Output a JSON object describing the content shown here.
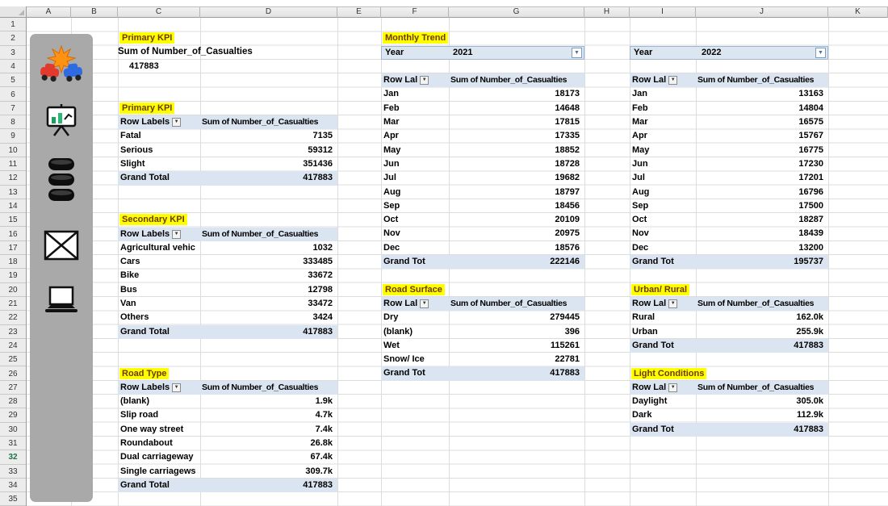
{
  "sheet": {
    "columns": [
      "A",
      "B",
      "C",
      "D",
      "E",
      "F",
      "G",
      "H",
      "I",
      "J",
      "K"
    ],
    "row_count": 35,
    "active_row": 32
  },
  "sidebar": {
    "icons": [
      "car-crash-icon",
      "presentation-chart-icon",
      "database-icon",
      "envelope-icon",
      "laptop-icon"
    ]
  },
  "kpi": {
    "title": "Primary KPI",
    "measure": "Sum of Number_of_Casualties",
    "value": "417883"
  },
  "monthly_trend": {
    "title": "Monthly Trend",
    "filters": [
      {
        "label": "Year",
        "value": "2021"
      },
      {
        "label": "Year",
        "value": "2022"
      }
    ]
  },
  "tables": {
    "primary_kpi": {
      "title": "Primary KPI",
      "header": [
        "Row Labels",
        "Sum of Number_of_Casualties"
      ],
      "rows": [
        [
          "Fatal",
          "7135"
        ],
        [
          "Serious",
          "59312"
        ],
        [
          "Slight",
          "351436"
        ]
      ],
      "total": [
        "Grand Total",
        "417883"
      ]
    },
    "secondary_kpi": {
      "title": "Secondary KPI",
      "header": [
        "Row Labels",
        "Sum of Number_of_Casualties"
      ],
      "rows": [
        [
          "Agricultural vehic",
          "1032"
        ],
        [
          "Cars",
          "333485"
        ],
        [
          "Bike",
          "33672"
        ],
        [
          "Bus",
          "12798"
        ],
        [
          "Van",
          "33472"
        ],
        [
          "Others",
          "3424"
        ]
      ],
      "total": [
        "Grand Total",
        "417883"
      ]
    },
    "road_type": {
      "title": "Road Type",
      "header": [
        "Row Labels",
        "Sum of Number_of_Casualties"
      ],
      "rows": [
        [
          "(blank)",
          "1.9k"
        ],
        [
          "Slip road",
          "4.7k"
        ],
        [
          "One way street",
          "7.4k"
        ],
        [
          "Roundabout",
          "26.8k"
        ],
        [
          "Dual carriageway",
          "67.4k"
        ],
        [
          "Single carriagews",
          "309.7k"
        ]
      ],
      "total": [
        "Grand Total",
        "417883"
      ]
    },
    "monthly_2021": {
      "header": [
        "Row Lal",
        "Sum of Number_of_Casualties"
      ],
      "rows": [
        [
          "Jan",
          "18173"
        ],
        [
          "Feb",
          "14648"
        ],
        [
          "Mar",
          "17815"
        ],
        [
          "Apr",
          "17335"
        ],
        [
          "May",
          "18852"
        ],
        [
          "Jun",
          "18728"
        ],
        [
          "Jul",
          "19682"
        ],
        [
          "Aug",
          "18797"
        ],
        [
          "Sep",
          "18456"
        ],
        [
          "Oct",
          "20109"
        ],
        [
          "Nov",
          "20975"
        ],
        [
          "Dec",
          "18576"
        ]
      ],
      "total": [
        "Grand Tot",
        "222146"
      ]
    },
    "monthly_2022": {
      "header": [
        "Row Lal",
        "Sum of Number_of_Casualties"
      ],
      "rows": [
        [
          "Jan",
          "13163"
        ],
        [
          "Feb",
          "14804"
        ],
        [
          "Mar",
          "16575"
        ],
        [
          "Apr",
          "15767"
        ],
        [
          "May",
          "16775"
        ],
        [
          "Jun",
          "17230"
        ],
        [
          "Jul",
          "17201"
        ],
        [
          "Aug",
          "16796"
        ],
        [
          "Sep",
          "17500"
        ],
        [
          "Oct",
          "18287"
        ],
        [
          "Nov",
          "18439"
        ],
        [
          "Dec",
          "13200"
        ]
      ],
      "total": [
        "Grand Tot",
        "195737"
      ]
    },
    "road_surface": {
      "title": "Road Surface",
      "header": [
        "Row Lal",
        "Sum of Number_of_Casualties"
      ],
      "rows": [
        [
          "Dry",
          "279445"
        ],
        [
          "(blank)",
          "396"
        ],
        [
          "Wet",
          "115261"
        ],
        [
          "Snow/ Ice",
          "22781"
        ]
      ],
      "total": [
        "Grand Tot",
        "417883"
      ]
    },
    "urban_rural": {
      "title": "Urban/ Rural",
      "header": [
        "Row Lal",
        "Sum of Number_of_Casualties"
      ],
      "rows": [
        [
          "Rural",
          "162.0k"
        ],
        [
          "Urban",
          "255.9k"
        ]
      ],
      "total": [
        "Grand Tot",
        "417883"
      ]
    },
    "light_conditions": {
      "title": "Light Conditions",
      "header": [
        "Row Lal",
        "Sum of Number_of_Casualties"
      ],
      "rows": [
        [
          "Daylight",
          "305.0k"
        ],
        [
          "Dark",
          "112.9k"
        ]
      ],
      "total": [
        "Grand Tot",
        "417883"
      ]
    }
  }
}
